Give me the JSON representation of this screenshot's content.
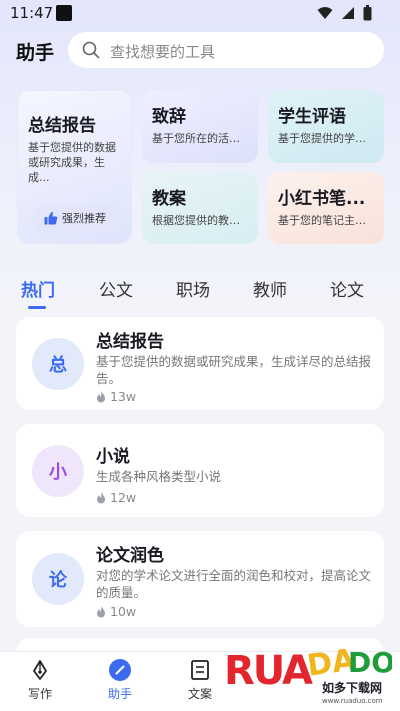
{
  "status": {
    "time": "11:47"
  },
  "header": {
    "title": "助手",
    "search_placeholder": "查找想要的工具"
  },
  "featured": {
    "big": {
      "title": "总结报告",
      "desc": "基于您提供的数据或研究成果，生成...",
      "button": "强烈推荐"
    },
    "cards": [
      {
        "title": "致辞",
        "desc": "基于您所在的活动..."
      },
      {
        "title": "学生评语",
        "desc": "基于您提供的学生..."
      },
      {
        "title": "教案",
        "desc": "根据您提供的教训..."
      },
      {
        "title": "小红书笔...",
        "desc": "基于您的笔记主题..."
      }
    ]
  },
  "tabs": [
    "热门",
    "公文",
    "职场",
    "教师",
    "论文"
  ],
  "list": [
    {
      "avatar": "总",
      "title": "总结报告",
      "desc": "基于您提供的数据或研究成果，生成详尽的总结报告。",
      "count": "13w"
    },
    {
      "avatar": "小",
      "title": "小说",
      "desc": "生成各种风格类型小说",
      "count": "12w"
    },
    {
      "avatar": "论",
      "title": "论文润色",
      "desc": "对您的学术论文进行全面的润色和校对，提高论文的质量。",
      "count": "10w"
    }
  ],
  "bottom_nav": [
    {
      "label": "写作"
    },
    {
      "label": "助手"
    },
    {
      "label": "文案"
    }
  ],
  "watermark": {
    "text": "RUANDAO",
    "sub": "如多下载网",
    "url": "www.ruaduo.com"
  },
  "colors": {
    "accent": "#3c6af0",
    "watermark_red": "#e3262d",
    "watermark_yellow": "#f2b51e",
    "watermark_green": "#1f9d3a"
  }
}
